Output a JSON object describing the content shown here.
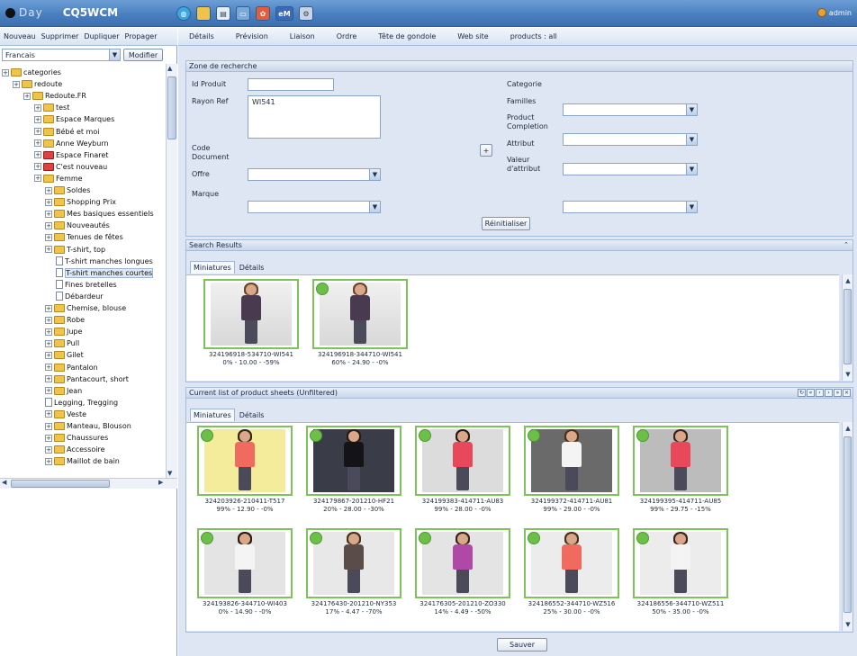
{
  "app": {
    "brand_day": "Day",
    "brand_product": "CQ5WCM",
    "user": "admin"
  },
  "toolbar_icons": [
    "globe-icon",
    "folder-icon",
    "page-icon",
    "window-icon",
    "flower-icon",
    "em-icon",
    "tool-icon"
  ],
  "left_menu": [
    "Nouveau",
    "Supprimer",
    "Dupliquer",
    "Propager"
  ],
  "language": {
    "value": "Francais",
    "modify_label": "Modifier"
  },
  "tree": [
    {
      "label": "categories",
      "depth": 0,
      "type": "folder"
    },
    {
      "label": "redoute",
      "depth": 1,
      "type": "folder"
    },
    {
      "label": "Redoute.FR",
      "depth": 2,
      "type": "folder"
    },
    {
      "label": "test",
      "depth": 3,
      "type": "folder"
    },
    {
      "label": "Espace Marques",
      "depth": 3,
      "type": "folder"
    },
    {
      "label": "Bébé et moi",
      "depth": 3,
      "type": "folder"
    },
    {
      "label": "Anne Weyburn",
      "depth": 3,
      "type": "folder"
    },
    {
      "label": "Espace Finaret",
      "depth": 3,
      "type": "folder-red"
    },
    {
      "label": "C'est nouveau",
      "depth": 3,
      "type": "folder-red"
    },
    {
      "label": "Femme",
      "depth": 3,
      "type": "folder"
    },
    {
      "label": "Soldes",
      "depth": 4,
      "type": "folder"
    },
    {
      "label": "Shopping Prix",
      "depth": 4,
      "type": "folder"
    },
    {
      "label": "Mes basiques essentiels",
      "depth": 4,
      "type": "folder"
    },
    {
      "label": "Nouveautés",
      "depth": 4,
      "type": "folder"
    },
    {
      "label": "Tenues de fêtes",
      "depth": 4,
      "type": "folder"
    },
    {
      "label": "T-shirt, top",
      "depth": 4,
      "type": "folder"
    },
    {
      "label": "T-shirt manches longues",
      "depth": 5,
      "type": "doc"
    },
    {
      "label": "T-shirt manches courtes",
      "depth": 5,
      "type": "doc",
      "selected": true
    },
    {
      "label": "Fines bretelles",
      "depth": 5,
      "type": "doc"
    },
    {
      "label": "Débardeur",
      "depth": 5,
      "type": "doc"
    },
    {
      "label": "Chemise, blouse",
      "depth": 4,
      "type": "folder"
    },
    {
      "label": "Robe",
      "depth": 4,
      "type": "folder"
    },
    {
      "label": "Jupe",
      "depth": 4,
      "type": "folder"
    },
    {
      "label": "Pull",
      "depth": 4,
      "type": "folder"
    },
    {
      "label": "Gilet",
      "depth": 4,
      "type": "folder"
    },
    {
      "label": "Pantalon",
      "depth": 4,
      "type": "folder"
    },
    {
      "label": "Pantacourt, short",
      "depth": 4,
      "type": "folder"
    },
    {
      "label": "Jean",
      "depth": 4,
      "type": "folder"
    },
    {
      "label": "Legging, Tregging",
      "depth": 4,
      "type": "doc"
    },
    {
      "label": "Veste",
      "depth": 4,
      "type": "folder"
    },
    {
      "label": "Manteau, Blouson",
      "depth": 4,
      "type": "folder"
    },
    {
      "label": "Chaussures",
      "depth": 4,
      "type": "folder"
    },
    {
      "label": "Accessoire",
      "depth": 4,
      "type": "folder"
    },
    {
      "label": "Maillot de bain",
      "depth": 4,
      "type": "folder"
    }
  ],
  "tabs": [
    "Détails",
    "Prévision",
    "Liaison",
    "Ordre",
    "Tête de gondole",
    "Web site",
    "products : all"
  ],
  "search": {
    "title": "Zone de recherche",
    "id_produit_label": "Id Produit",
    "id_produit_value": "",
    "rayon_ref_label": "Rayon Ref",
    "rayon_ref_value": "WI541",
    "code_document_label": "Code Document",
    "offre_label": "Offre",
    "marque_label": "Marque",
    "categorie_label": "Categorie",
    "familles_label": "Familles",
    "product_completion_label": "Product Completion",
    "attribut_label": "Attribut",
    "valeur_attribut_label": "Valeur d'attribut",
    "add_label": "+",
    "reset_label": "Réinitialiser"
  },
  "results": {
    "title": "Search Results",
    "tab_miniatures": "Miniatures",
    "tab_details": "Détails",
    "items": [
      {
        "caption1": "324196918-534710-WI541",
        "caption2": "0% - 10.00 - -59%",
        "green": false,
        "top": "#4a3a50",
        "hair": "#6a4428"
      },
      {
        "caption1": "324196918-344710-WI541",
        "caption2": "60% - 24.90 - -0%",
        "green": true,
        "top": "#4a3a50",
        "hair": "#6a4428"
      }
    ]
  },
  "current": {
    "title": "Current list of product sheets (Unfiltered)",
    "tab_miniatures": "Miniatures",
    "tab_details": "Détails",
    "pager_icons": [
      "refresh-icon",
      "first-icon",
      "prev-icon",
      "next-icon",
      "last-icon",
      "close-icon"
    ],
    "items": [
      {
        "caption1": "324203926-210411-T517",
        "caption2": "99% - 12.90 - -0%",
        "top": "#f06a60",
        "bg": "#f4ec9a",
        "hair": "#3a2418"
      },
      {
        "caption1": "324179867-201210-HF21",
        "caption2": "20% - 28.00 - -30%",
        "top": "#141418",
        "bg": "#3a3c48",
        "hair": "#2a1a10"
      },
      {
        "caption1": "324199383-414711-AU83",
        "caption2": "99% - 28.00 - -0%",
        "top": "#e8485a",
        "bg": "#dcdcdc",
        "hair": "#2a1a10"
      },
      {
        "caption1": "324199372-414711-AU81",
        "caption2": "99% - 29.00 - -0%",
        "top": "#f4f4f4",
        "bg": "#6a6a6a",
        "hair": "#4a3018"
      },
      {
        "caption1": "324199395-414711-AU85",
        "caption2": "99% - 29.75 - -15%",
        "top": "#e8485a",
        "bg": "#bcbcbc",
        "hair": "#3a2418"
      },
      {
        "caption1": "324193826-344710-WI403",
        "caption2": "0% - 14.90 - -0%",
        "top": "#f4f4f4",
        "bg": "#e4e4e4",
        "hair": "#2a1a10"
      },
      {
        "caption1": "324176430-201210-NY353",
        "caption2": "17% - 4.47 - -70%",
        "top": "#5a4c48",
        "bg": "#e8e8e8",
        "hair": "#4a3018"
      },
      {
        "caption1": "324176305-201210-ZO330",
        "caption2": "14% - 4.49 - -50%",
        "top": "#b048a8",
        "bg": "#e4e4e4",
        "hair": "#3a2418"
      },
      {
        "caption1": "324186552-344710-WZ516",
        "caption2": "25% - 30.00 - -0%",
        "top": "#f06a60",
        "bg": "#ececec",
        "hair": "#4a3018"
      },
      {
        "caption1": "324186556-344710-WZ511",
        "caption2": "50% - 35.00 - -0%",
        "top": "#f4f4f4",
        "bg": "#ececec",
        "hair": "#3a2418"
      }
    ]
  },
  "save_label": "Sauver",
  "colors": {
    "thumb_border": "#7cc35a",
    "accent": "#4a7fc0"
  }
}
